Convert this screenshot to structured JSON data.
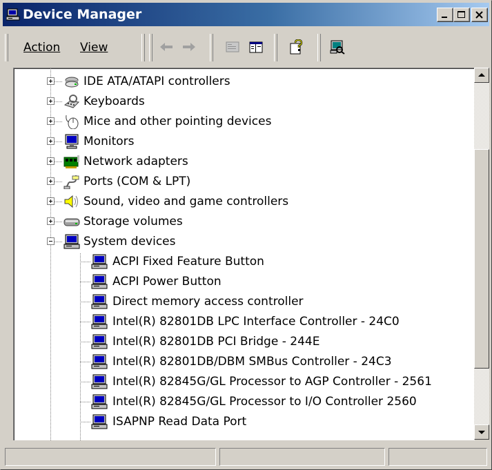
{
  "window": {
    "title": "Device Manager",
    "title_icon": "device-manager-icon",
    "controls": [
      "minimize",
      "maximize",
      "close"
    ]
  },
  "menu": {
    "action": "Action",
    "view": "View"
  },
  "toolbar": {
    "buttons": [
      "back",
      "forward",
      "properties",
      "show-hide-console-tree",
      "help",
      "scan-hardware-changes"
    ]
  },
  "tree": {
    "categories": [
      {
        "label": "IDE ATA/ATAPI controllers",
        "icon": "ide-controller-icon",
        "expanded": false
      },
      {
        "label": "Keyboards",
        "icon": "keyboard-icon",
        "expanded": false
      },
      {
        "label": "Mice and other pointing devices",
        "icon": "mouse-icon",
        "expanded": false
      },
      {
        "label": "Monitors",
        "icon": "monitor-icon",
        "expanded": false
      },
      {
        "label": "Network adapters",
        "icon": "network-adapter-icon",
        "expanded": false
      },
      {
        "label": "Ports (COM & LPT)",
        "icon": "port-icon",
        "expanded": false
      },
      {
        "label": "Sound, video and game controllers",
        "icon": "speaker-icon",
        "expanded": false
      },
      {
        "label": "Storage volumes",
        "icon": "storage-volume-icon",
        "expanded": false
      },
      {
        "label": "System devices",
        "icon": "system-device-icon",
        "expanded": true
      }
    ],
    "system_devices": [
      "ACPI Fixed Feature Button",
      "ACPI Power Button",
      "Direct memory access controller",
      "Intel(R) 82801DB LPC Interface Controller - 24C0",
      "Intel(R) 82801DB PCI Bridge - 244E",
      "Intel(R) 82801DB/DBM SMBus Controller - 24C3",
      "Intel(R) 82845G/GL Processor to AGP Controller - 2561",
      "Intel(R) 82845G/GL Processor to I/O Controller 2560",
      "ISAPNP Read Data Port"
    ]
  },
  "statusbar": {
    "panels": [
      "",
      "",
      ""
    ]
  },
  "colors": {
    "title_gradient_start": "#0a246a",
    "title_gradient_end": "#a6caf0",
    "face": "#d4d0c8"
  }
}
